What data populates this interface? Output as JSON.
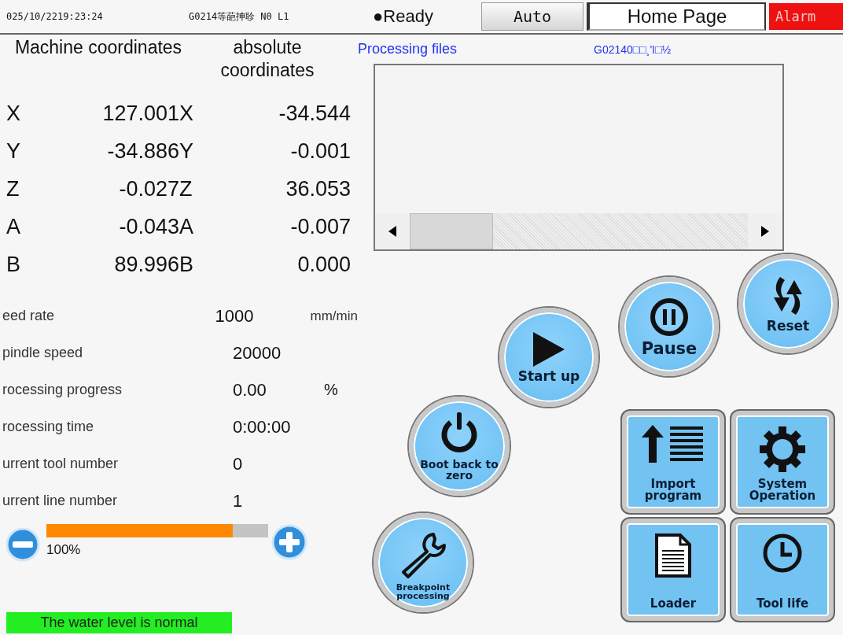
{
  "status_bar": {
    "datetime": "025/10/2219:23:24",
    "program": "G0214等葩抻聄 N0 L1",
    "state": "●Ready",
    "mode_tabs": [
      {
        "label": "Auto",
        "selected": false
      },
      {
        "label": "Home Page",
        "selected": true
      }
    ],
    "alarm": {
      "label": "Alarm",
      "active": true
    }
  },
  "coordinates": {
    "machine_heading": "Machine coordinates",
    "absolute_heading": "absolute coordinates",
    "rows": [
      {
        "axis": "X",
        "machine": "127.001",
        "axis_abs": "X",
        "absolute": "-34.544"
      },
      {
        "axis": "Y",
        "machine": "-34.886",
        "axis_abs": "Y",
        "absolute": "-0.001"
      },
      {
        "axis": "Z",
        "machine": "-0.027",
        "axis_abs": "Z",
        "absolute": "36.053"
      },
      {
        "axis": "A",
        "machine": "-0.043",
        "axis_abs": "A",
        "absolute": "-0.007"
      },
      {
        "axis": "B",
        "machine": "89.996",
        "axis_abs": "B",
        "absolute": "0.000"
      }
    ]
  },
  "parameters": [
    {
      "label": "eed rate",
      "value": "1000",
      "unit": "mm/min"
    },
    {
      "label": "pindle speed",
      "value": "20000"
    },
    {
      "label": "rocessing progress",
      "value": "0.00",
      "unit": "%"
    },
    {
      "label": "rocessing time",
      "value": "0:00:00"
    },
    {
      "label": "urrent tool number",
      "value": "0"
    },
    {
      "label": "urrent line number",
      "value": "1"
    }
  ],
  "feed_override": {
    "level": 0.84,
    "reading": "100%"
  },
  "water_status": "The water level is normal",
  "processing_files": {
    "label": "Processing files",
    "filename": "G02140□□¸'I□½"
  },
  "buttons": [
    {
      "kind": "round",
      "label": "Reset"
    },
    {
      "kind": "round",
      "label": "Pause"
    },
    {
      "kind": "round",
      "label": "Start up"
    },
    {
      "kind": "round",
      "label": "Boot back to zero"
    },
    {
      "kind": "round",
      "label": "Breakpoint processing"
    },
    {
      "kind": "square",
      "label": "Import program"
    },
    {
      "kind": "square",
      "label": "System Operation"
    },
    {
      "kind": "square",
      "label": "Loader"
    },
    {
      "kind": "square",
      "label": "Tool life"
    }
  ]
}
